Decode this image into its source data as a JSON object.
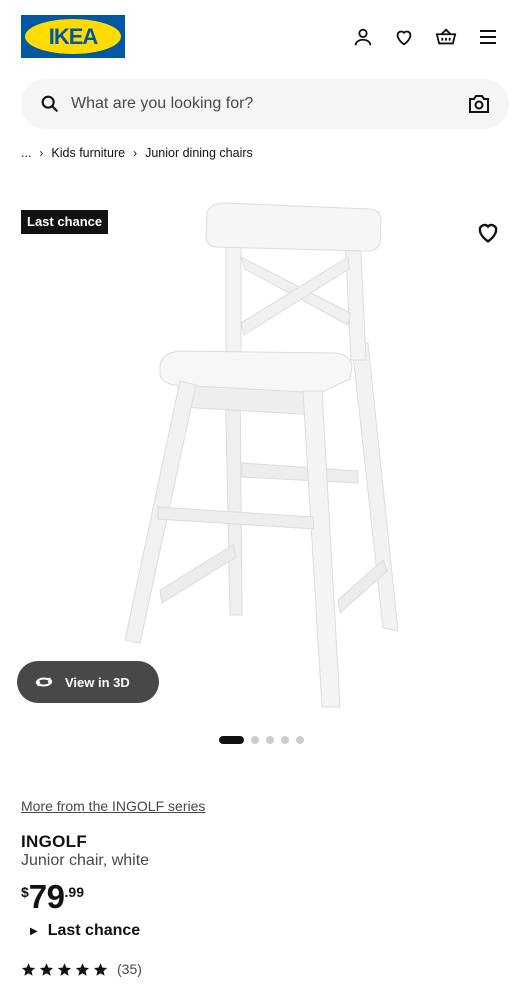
{
  "header": {
    "logo_text": "IKEA",
    "icons": [
      "user-icon",
      "heart-icon",
      "basket-icon",
      "menu-icon"
    ]
  },
  "search": {
    "placeholder": "What are you looking for?",
    "value": ""
  },
  "breadcrumb": {
    "ellipsis": "...",
    "items": [
      "Kids furniture",
      "Junior dining chairs"
    ]
  },
  "product": {
    "badge": "Last chance",
    "view3d_label": "View in 3D",
    "carousel": {
      "total": 5,
      "active": 1
    },
    "series_link": "More from the INGOLF series",
    "name": "INGOLF",
    "description": "Junior chair, white",
    "price": {
      "currency": "$",
      "integer": "79",
      "decimal": ".99"
    },
    "availability": "Last chance",
    "rating": {
      "stars": 5,
      "count": "(35)"
    }
  },
  "colors": {
    "brand_blue": "#0058a3",
    "brand_yellow": "#ffdb00",
    "text": "#111111",
    "muted": "#484848"
  }
}
